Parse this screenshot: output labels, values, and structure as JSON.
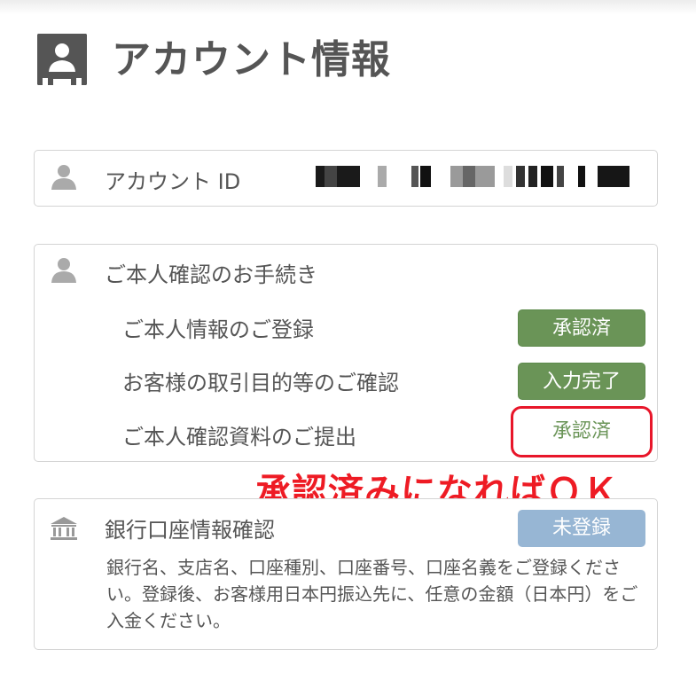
{
  "page": {
    "title": "アカウント情報"
  },
  "account": {
    "label": "アカウント ID"
  },
  "identity": {
    "heading": "ご本人確認のお手続き",
    "items": [
      {
        "label": "ご本人情報のご登録",
        "status": "承認済"
      },
      {
        "label": "お客様の取引目的等のご確認",
        "status": "入力完了"
      },
      {
        "label": "ご本人確認資料のご提出",
        "status": "承認済"
      }
    ]
  },
  "annotation": {
    "text": "承認済みになればＯＫ"
  },
  "bank": {
    "heading": "銀行口座情報確認",
    "status": "未登録",
    "description": "銀行名、支店名、口座種別、口座番号、口座名義をご登録ください。登録後、お客様用日本円振込先に、任意の金額（日本円）をご入金ください。"
  },
  "colors": {
    "text": "#555555",
    "badge_green": "#6a9457",
    "badge_blue": "#97b6d4",
    "highlight_red": "#ee1b24"
  }
}
